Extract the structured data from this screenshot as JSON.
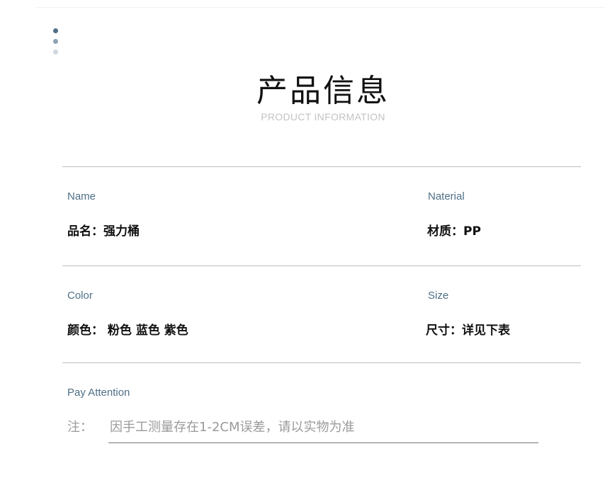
{
  "header": {
    "title": "产品信息",
    "subtitle": "PRODUCT INFORMATION"
  },
  "fields": {
    "name": {
      "label": "Name",
      "value": "品名：强力桶"
    },
    "material": {
      "label": "Naterial",
      "value": "材质：PP"
    },
    "color": {
      "label": "Color",
      "value": "颜色： 粉色 蓝色 紫色"
    },
    "size": {
      "label": "Size",
      "value": "尺寸：详见下表"
    },
    "attention": {
      "label": "Pay Attention",
      "prefix": "注：",
      "text": "因手工测量存在1-2CM误差，请以实物为准"
    }
  },
  "colors": {
    "accent": "#4e6f86",
    "divider": "#bdbdbd",
    "note_text": "#9a9a9a"
  }
}
